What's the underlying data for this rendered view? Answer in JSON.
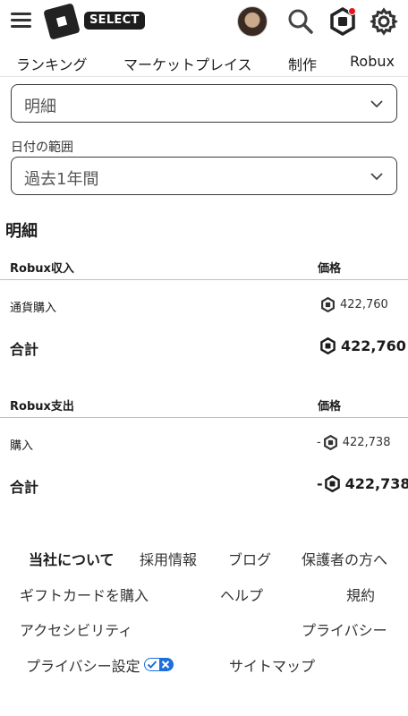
{
  "header": {
    "select_badge": "SELECT",
    "icons": [
      "menu-icon",
      "roblox-logo",
      "avatar",
      "search-icon",
      "robux-icon",
      "gear-icon"
    ]
  },
  "nav": {
    "tabs": [
      "ランキング",
      "マーケットプレイス",
      "制作",
      "Robux"
    ]
  },
  "filters": {
    "type_value": "明細",
    "date_label": "日付の範囲",
    "date_value": "過去1年間"
  },
  "section_title": "明細",
  "income": {
    "header_name": "Robux収入",
    "header_price": "価格",
    "rows": [
      {
        "name": "通貨購入",
        "amount": "422,760"
      }
    ],
    "total_label": "合計",
    "total_amount": "422,760"
  },
  "expense": {
    "header_name": "Robux支出",
    "header_price": "価格",
    "rows": [
      {
        "name": "購入",
        "sign": "-",
        "amount": "422,738"
      }
    ],
    "total_label": "合計",
    "total_sign": "-",
    "total_amount": "422,738"
  },
  "footer": {
    "links": [
      "当社について",
      "採用情報",
      "ブログ",
      "保護者の方へ",
      "ギフトカードを購入",
      "ヘルプ",
      "規約",
      "アクセシビリティ",
      "プライバシー",
      "プライバシー設定",
      "サイトマップ"
    ]
  },
  "colors": {
    "notification": "#e8141e",
    "toggle": "#1e6fd9"
  }
}
